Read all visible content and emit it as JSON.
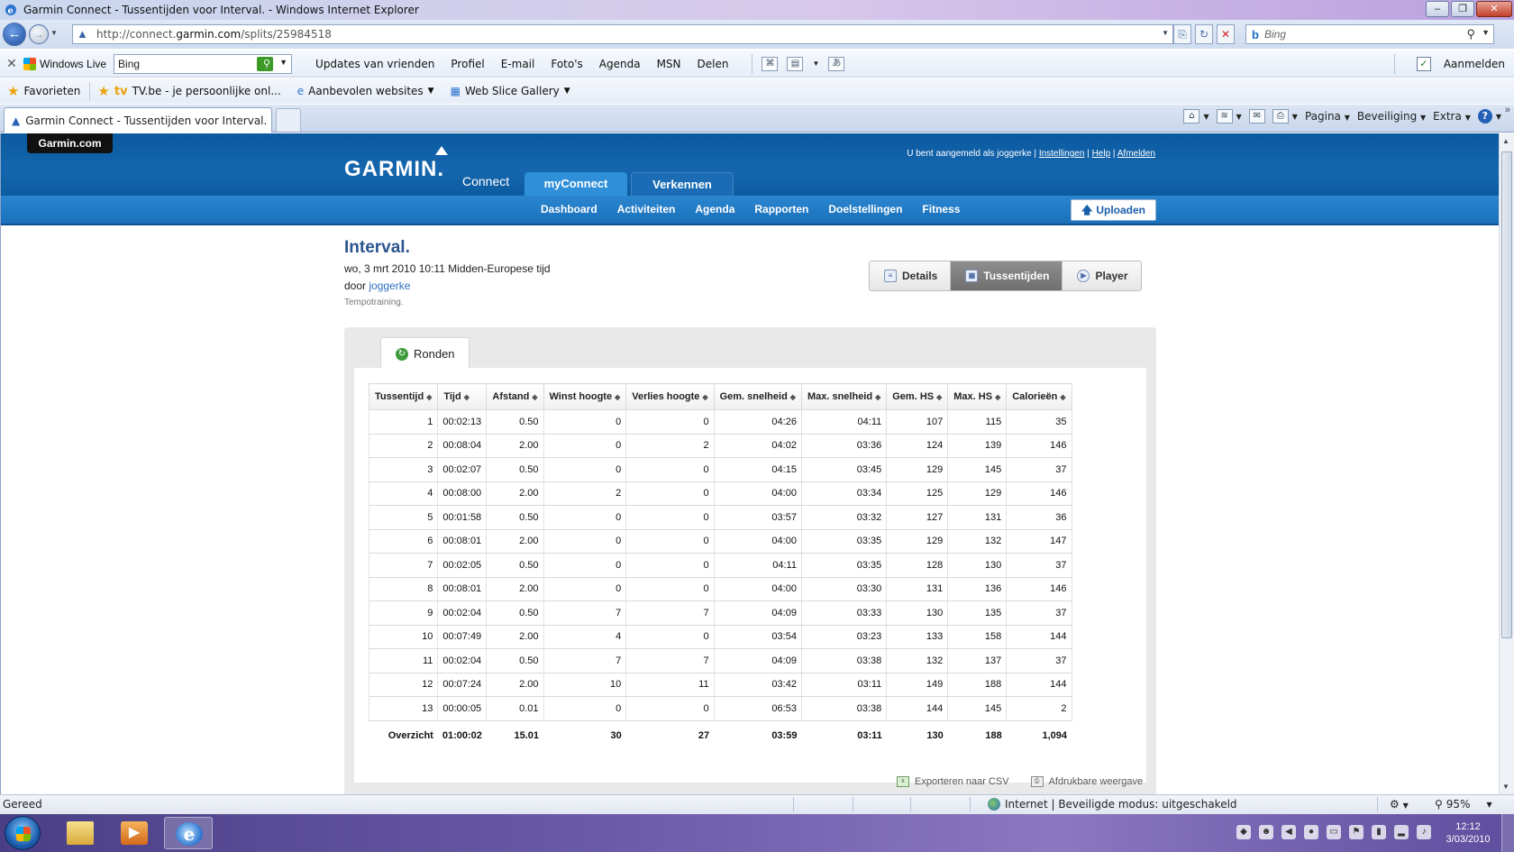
{
  "window": {
    "title": "Garmin Connect - Tussentijden voor Interval. - Windows Internet Explorer",
    "buttons": [
      "minimize",
      "restore",
      "close"
    ]
  },
  "addressbar": {
    "url_prefix": "http://connect.",
    "url_domain": "garmin.com",
    "url_path": "/splits/25984518"
  },
  "search": {
    "placeholder": "Bing"
  },
  "livebar": {
    "brand": "Windows Live",
    "search_value": "Bing",
    "links": [
      "Updates van vrienden",
      "Profiel",
      "E-mail",
      "Foto's",
      "Agenda",
      "MSN",
      "Delen"
    ],
    "signin": "Aanmelden"
  },
  "favorites": {
    "label": "Favorieten",
    "items": [
      {
        "logo": "tv",
        "label": "TV.be - je persoonlijke onl..."
      },
      {
        "label": "Aanbevolen websites"
      },
      {
        "label": "Web Slice Gallery"
      }
    ]
  },
  "tab": {
    "label": "Garmin Connect - Tussentijden voor Interval."
  },
  "commandbar": {
    "pagina": "Pagina",
    "beveiliging": "Beveiliging",
    "extra": "Extra"
  },
  "garmin": {
    "garmincom": "Garmin.com",
    "logo": "GARMIN.",
    "connect": "Connect",
    "toptabs": [
      "myConnect",
      "Verkennen"
    ],
    "user": {
      "prefix": "U bent aangemeld als joggerke",
      "settings": "Instellingen",
      "help": "Help",
      "logout": "Afmelden"
    },
    "subnav": [
      "Dashboard",
      "Activiteiten",
      "Agenda",
      "Rapporten",
      "Doelstellingen",
      "Fitness"
    ],
    "upload": "Uploaden"
  },
  "activity": {
    "title": "Interval.",
    "date": "wo, 3 mrt 2010 10:11 Midden-Europese tijd",
    "by_prefix": "door",
    "user": "joggerke",
    "type": "Tempotraining.",
    "views": [
      "Details",
      "Tussentijden",
      "Player"
    ],
    "active_view": "Tussentijden",
    "subtab": "Ronden"
  },
  "table": {
    "headers": [
      "Tussentijd",
      "Tijd",
      "Afstand",
      "Winst hoogte",
      "Verlies hoogte",
      "Gem. snelheid",
      "Max. snelheid",
      "Gem. HS",
      "Max. HS",
      "Calorieën"
    ],
    "rows": [
      [
        "1",
        "00:02:13",
        "0.50",
        "0",
        "0",
        "04:26",
        "04:11",
        "107",
        "115",
        "35"
      ],
      [
        "2",
        "00:08:04",
        "2.00",
        "0",
        "2",
        "04:02",
        "03:36",
        "124",
        "139",
        "146"
      ],
      [
        "3",
        "00:02:07",
        "0.50",
        "0",
        "0",
        "04:15",
        "03:45",
        "129",
        "145",
        "37"
      ],
      [
        "4",
        "00:08:00",
        "2.00",
        "2",
        "0",
        "04:00",
        "03:34",
        "125",
        "129",
        "146"
      ],
      [
        "5",
        "00:01:58",
        "0.50",
        "0",
        "0",
        "03:57",
        "03:32",
        "127",
        "131",
        "36"
      ],
      [
        "6",
        "00:08:01",
        "2.00",
        "0",
        "0",
        "04:00",
        "03:35",
        "129",
        "132",
        "147"
      ],
      [
        "7",
        "00:02:05",
        "0.50",
        "0",
        "0",
        "04:11",
        "03:35",
        "128",
        "130",
        "37"
      ],
      [
        "8",
        "00:08:01",
        "2.00",
        "0",
        "0",
        "04:00",
        "03:30",
        "131",
        "136",
        "146"
      ],
      [
        "9",
        "00:02:04",
        "0.50",
        "7",
        "7",
        "04:09",
        "03:33",
        "130",
        "135",
        "37"
      ],
      [
        "10",
        "00:07:49",
        "2.00",
        "4",
        "0",
        "03:54",
        "03:23",
        "133",
        "158",
        "144"
      ],
      [
        "11",
        "00:02:04",
        "0.50",
        "7",
        "7",
        "04:09",
        "03:38",
        "132",
        "137",
        "37"
      ],
      [
        "12",
        "00:07:24",
        "2.00",
        "10",
        "11",
        "03:42",
        "03:11",
        "149",
        "188",
        "144"
      ],
      [
        "13",
        "00:00:05",
        "0.01",
        "0",
        "0",
        "06:53",
        "03:38",
        "144",
        "145",
        "2"
      ]
    ],
    "total": [
      "Overzicht",
      "01:00:02",
      "15.01",
      "30",
      "27",
      "03:59",
      "03:11",
      "130",
      "188",
      "1,094"
    ]
  },
  "exports": {
    "csv": "Exporteren naar CSV",
    "print": "Afdrukbare weergave"
  },
  "statusbar": {
    "ready": "Gereed",
    "zone": "Internet | Beveiligde modus: uitgeschakeld",
    "zoom": "95%"
  },
  "clock": {
    "time": "12:12",
    "date": "3/03/2010"
  }
}
